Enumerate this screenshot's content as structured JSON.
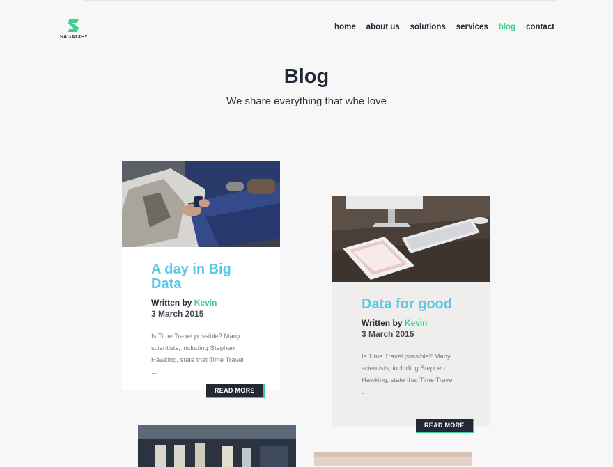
{
  "brand": {
    "name": "SAGACIFY",
    "color": "#3dcf8b"
  },
  "nav": {
    "items": [
      {
        "label": "home",
        "active": false
      },
      {
        "label": "about us",
        "active": false
      },
      {
        "label": "solutions",
        "active": false
      },
      {
        "label": "services",
        "active": false
      },
      {
        "label": "blog",
        "active": true
      },
      {
        "label": "contact",
        "active": false
      }
    ]
  },
  "hero": {
    "title": "Blog",
    "subtitle": "We share everything that whe love"
  },
  "posts": [
    {
      "title": "A day in Big Data",
      "written_by": "Written by",
      "author": "Kevin",
      "date": "3 March 2015",
      "excerpt": "Is Time Travel possible? Many scientists, including Stephen Hawking, state that Time Travel ...",
      "button": "READ MORE",
      "image": "people-sitting-with-phone"
    },
    {
      "title": "Data for good",
      "written_by": "Written by",
      "author": "Kevin",
      "date": "3 March 2015",
      "excerpt": "Is Time Travel possible? Many scientists, including Stephen Hawking, state that Time Travel ...",
      "button": "READ MORE",
      "image": "desk-with-tablet-and-keyboard"
    }
  ],
  "colors": {
    "accent": "#3dcf8b",
    "title_blue": "#5bc8e8",
    "dark": "#222836"
  }
}
